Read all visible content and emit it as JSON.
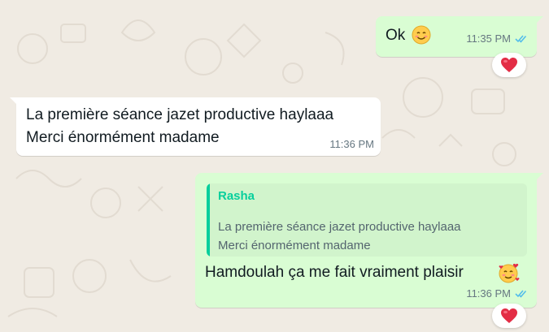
{
  "messages": [
    {
      "direction": "outgoing",
      "text": "Ok",
      "emoji": "smiling-face",
      "time": "11:35 PM",
      "status": "read",
      "reaction": "red-heart"
    },
    {
      "direction": "incoming",
      "lines": [
        "La première séance jazet productive haylaaa",
        "Merci énormément madame"
      ],
      "time": "11:36 PM"
    },
    {
      "direction": "outgoing",
      "quote": {
        "author": "Rasha",
        "lines": [
          "La première séance jazet productive haylaaa",
          "Merci énormément madame"
        ]
      },
      "text": "Hamdoulah ça me fait vraiment plaisir",
      "emoji": "smiling-face-with-hearts",
      "time": "11:36 PM",
      "status": "read",
      "reaction": "red-heart"
    }
  ],
  "colors": {
    "outgoing": "#d9fdd3",
    "incoming": "#ffffff",
    "quote_accent": "#06cf9c",
    "read_ticks": "#53bdeb",
    "wallpaper": "#f0ebe3"
  }
}
